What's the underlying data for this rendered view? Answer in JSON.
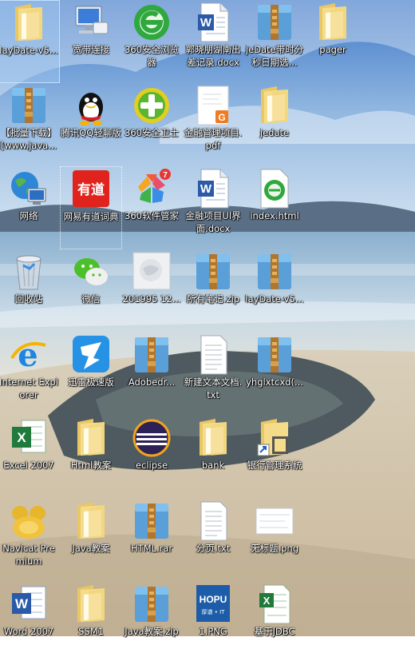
{
  "desktop": {
    "wallpaper": "beach-coast",
    "icons": [
      {
        "label": "layDate-v5...",
        "icon": "folder",
        "selected": true
      },
      {
        "label": "宽带连接",
        "icon": "network-connection"
      },
      {
        "label": "360安全浏览器",
        "icon": "browser-360"
      },
      {
        "label": "郭晓朋湖南出差记录.docx",
        "icon": "word-doc"
      },
      {
        "label": "jeDate带时分秒日期选...",
        "icon": "archive"
      },
      {
        "label": "pager",
        "icon": "folder"
      },
      {
        "label": "【批量下载】[www.java...",
        "icon": "archive"
      },
      {
        "label": "腾讯QQ轻聊版",
        "icon": "qq"
      },
      {
        "label": "360安全卫士",
        "icon": "security-360"
      },
      {
        "label": "金融管理项目.pdf",
        "icon": "pdf"
      },
      {
        "label": "jedate",
        "icon": "folder"
      },
      {
        "label": "网络",
        "icon": "network"
      },
      {
        "label": "网易有道词典",
        "icon": "youdao",
        "focused": true
      },
      {
        "label": "360软件管家",
        "icon": "software-manager",
        "badge": "7"
      },
      {
        "label": "金融项目UI界面.docx",
        "icon": "word-doc"
      },
      {
        "label": "index.html",
        "icon": "html-file"
      },
      {
        "label": "回收站",
        "icon": "recycle-bin"
      },
      {
        "label": "微信",
        "icon": "wechat"
      },
      {
        "label": "201995 12...",
        "icon": "image-thumb"
      },
      {
        "label": "所有笔记.zip",
        "icon": "archive"
      },
      {
        "label": "layDate-v5...",
        "icon": "archive"
      },
      {
        "label": "Internet Explorer",
        "icon": "ie"
      },
      {
        "label": "迅雷极速版",
        "icon": "thunder"
      },
      {
        "label": "Adobedr...",
        "icon": "archive"
      },
      {
        "label": "新建文本文档.txt",
        "icon": "text-file"
      },
      {
        "label": "yhglxtcxd(...",
        "icon": "archive"
      },
      {
        "label": "Excel 2007",
        "icon": "excel"
      },
      {
        "label": "Html教案",
        "icon": "folder"
      },
      {
        "label": "eclipse",
        "icon": "eclipse"
      },
      {
        "label": "bank",
        "icon": "folder"
      },
      {
        "label": "银行管理系统",
        "icon": "folder-shortcut"
      },
      {
        "label": "Navicat Premium",
        "icon": "navicat"
      },
      {
        "label": "Java教案",
        "icon": "folder"
      },
      {
        "label": "HTML.rar",
        "icon": "archive"
      },
      {
        "label": "分页.txt",
        "icon": "text-file"
      },
      {
        "label": "无标题.png",
        "icon": "png-file"
      },
      {
        "label": "Word 2007",
        "icon": "word-app"
      },
      {
        "label": "SSM1",
        "icon": "folder"
      },
      {
        "label": "Java教案.zip",
        "icon": "archive"
      },
      {
        "label": "1.PNG",
        "icon": "hopu-image",
        "text": "HOPU",
        "subtext": "厚谱 • IT"
      },
      {
        "label": "基于JDBC",
        "icon": "excel-file"
      }
    ]
  }
}
